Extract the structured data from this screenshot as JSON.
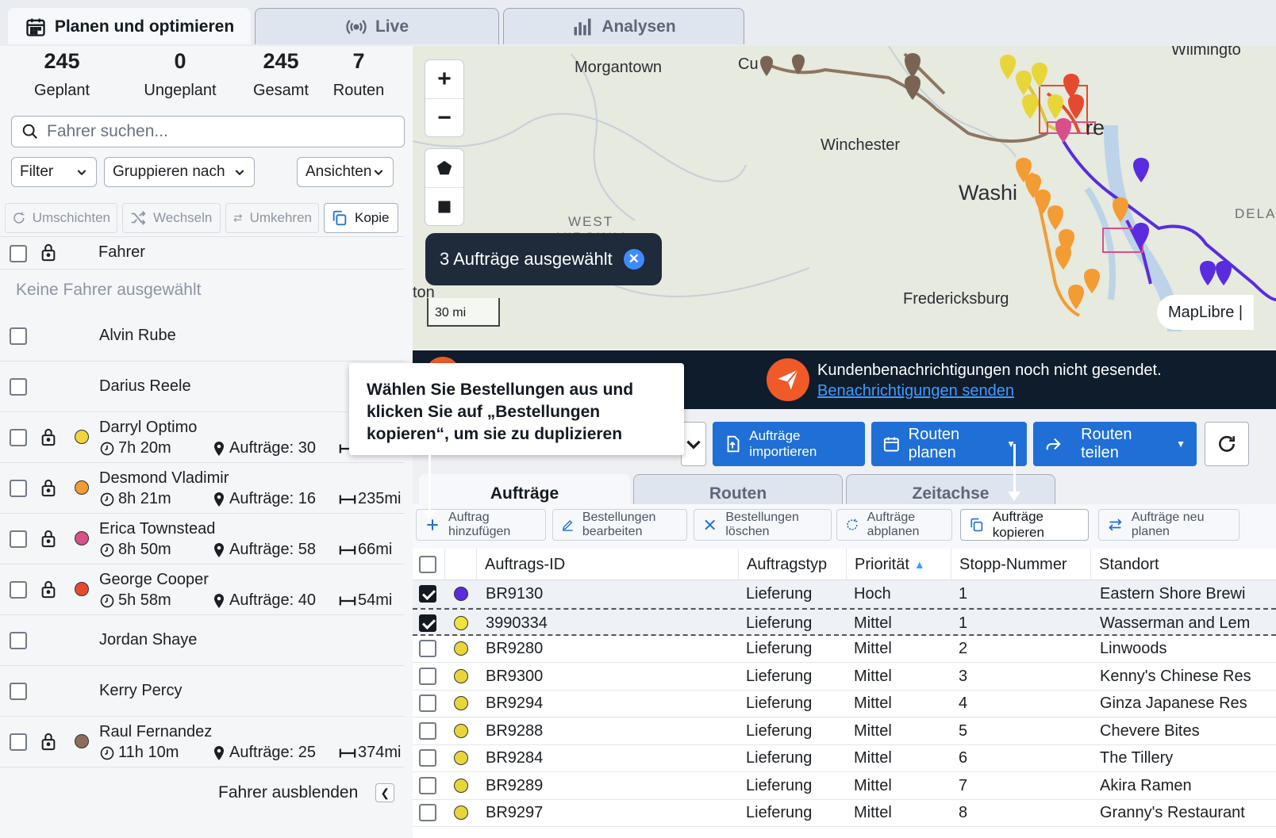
{
  "top_tabs": [
    {
      "label": "Planen und optimieren",
      "icon": "calendar-icon",
      "active": true
    },
    {
      "label": "Live",
      "icon": "broadcast-icon",
      "active": false
    },
    {
      "label": "Analysen",
      "icon": "bar-chart-icon",
      "active": false
    }
  ],
  "stats": [
    {
      "value": "245",
      "label": "Geplant"
    },
    {
      "value": "0",
      "label": "Ungeplant"
    },
    {
      "value": "245",
      "label": "Gesamt"
    },
    {
      "value": "7",
      "label": "Routen"
    }
  ],
  "search": {
    "placeholder": "Fahrer suchen..."
  },
  "dropdowns": {
    "filter": "Filter",
    "group": "Gruppieren nach",
    "views": "Ansichten"
  },
  "driver_tools": [
    "Umschichten",
    "Wechseln",
    "Umkehren",
    "Kopie"
  ],
  "driver_header": "Fahrer",
  "no_driver": "Keine Fahrer ausgewählt",
  "drivers": [
    {
      "name": "Alvin Rube"
    },
    {
      "name": "Darius Reele"
    },
    {
      "name": "Darryl Optimo",
      "time": "7h 20m",
      "orders": "Aufträge: 30",
      "dist": "1...",
      "color": "#f2d33a"
    },
    {
      "name": "Desmond Vladimir",
      "time": "8h 21m",
      "orders": "Aufträge: 16",
      "dist": "235mi",
      "color": "#f39c33"
    },
    {
      "name": "Erica Townstead",
      "time": "8h 50m",
      "orders": "Aufträge: 58",
      "dist": "66mi",
      "color": "#d84f8a"
    },
    {
      "name": "George Cooper",
      "time": "5h 58m",
      "orders": "Aufträge: 40",
      "dist": "54mi",
      "color": "#e64a2e"
    },
    {
      "name": "Jordan Shaye"
    },
    {
      "name": "Kerry Percy"
    },
    {
      "name": "Raul Fernandez",
      "time": "11h 10m",
      "orders": "Aufträge: 25",
      "dist": "374mi",
      "color": "#8b6d5a"
    }
  ],
  "hide_drivers": "Fahrer ausblenden",
  "map": {
    "labels": [
      "Morgantown",
      "Winchester",
      "Washi",
      "WEST",
      "VIRGINIA",
      "Fredericksburg",
      "DELAW",
      "ton",
      "Wilmingto",
      "Cu",
      "re"
    ],
    "selected_pill": "3 Aufträge ausgewählt",
    "scale": "30 mi",
    "attribution": "MapLibre |"
  },
  "notification": {
    "text": "Kundenbenachrichtigungen noch nicht gesendet.",
    "link": "Benachrichtigungen senden"
  },
  "actions": {
    "import": "Aufträge importieren",
    "plan": "Routen planen",
    "share": "Routen teilen"
  },
  "order_tabs": [
    "Aufträge",
    "Routen",
    "Zeitachse"
  ],
  "order_tools": [
    "Auftrag hinzufügen",
    "Bestellungen bearbeiten",
    "Bestellungen löschen",
    "Aufträge abplanen",
    "Aufträge kopieren",
    "Aufträge neu planen"
  ],
  "table": {
    "headers": [
      "Auftrags-ID",
      "Auftragstyp",
      "Priorität",
      "Stopp-Nummer",
      "Standort"
    ],
    "rows": [
      {
        "id": "BR9130",
        "type": "Lieferung",
        "prio": "Hoch",
        "stop": "1",
        "loc": "Eastern Shore Brewi",
        "checked": true,
        "color": "#5b2be0"
      },
      {
        "id": "3990334",
        "type": "Lieferung",
        "prio": "Mittel",
        "stop": "1",
        "loc": "Wasserman and Lem",
        "checked": true,
        "color": "#f2e33a"
      },
      {
        "id": "BR9280",
        "type": "Lieferung",
        "prio": "Mittel",
        "stop": "2",
        "loc": "Linwoods",
        "checked": false,
        "color": "#e8d53a"
      },
      {
        "id": "BR9300",
        "type": "Lieferung",
        "prio": "Mittel",
        "stop": "3",
        "loc": "Kenny's Chinese Res",
        "checked": false,
        "color": "#e8d53a"
      },
      {
        "id": "BR9294",
        "type": "Lieferung",
        "prio": "Mittel",
        "stop": "4",
        "loc": "Ginza Japanese Res",
        "checked": false,
        "color": "#e8d53a"
      },
      {
        "id": "BR9288",
        "type": "Lieferung",
        "prio": "Mittel",
        "stop": "5",
        "loc": "Chevere Bites",
        "checked": false,
        "color": "#e8d53a"
      },
      {
        "id": "BR9284",
        "type": "Lieferung",
        "prio": "Mittel",
        "stop": "6",
        "loc": "The Tillery",
        "checked": false,
        "color": "#e8d53a"
      },
      {
        "id": "BR9289",
        "type": "Lieferung",
        "prio": "Mittel",
        "stop": "7",
        "loc": "Akira Ramen",
        "checked": false,
        "color": "#e8d53a"
      },
      {
        "id": "BR9297",
        "type": "Lieferung",
        "prio": "Mittel",
        "stop": "8",
        "loc": "Granny's Restaurant",
        "checked": false,
        "color": "#e8d53a"
      }
    ]
  },
  "tooltip": "Wählen Sie Bestellungen aus und klicken Sie auf „Bestellungen kopieren“, um sie zu duplizieren"
}
